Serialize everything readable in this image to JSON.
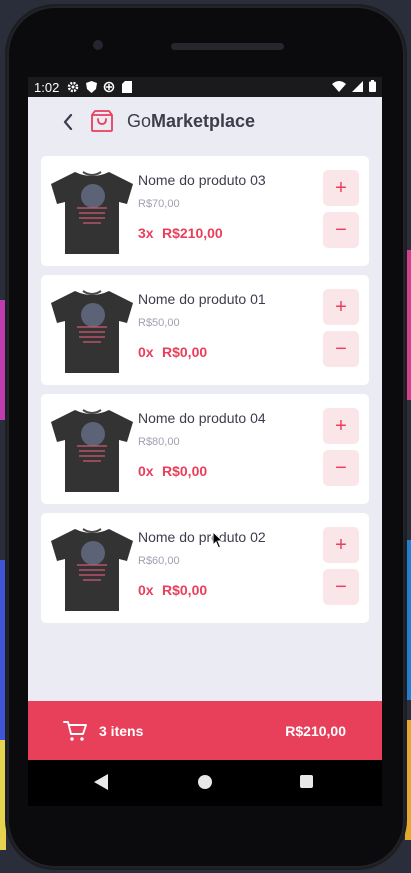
{
  "status": {
    "time": "1:02",
    "icons": [
      "gear-icon",
      "shield-icon",
      "data-saver-icon",
      "sd-card-icon"
    ],
    "right_icons": [
      "wifi-icon",
      "signal-icon",
      "battery-icon"
    ]
  },
  "header": {
    "title_prefix": "Go",
    "title_bold": "Marketplace",
    "back_icon": "chevron-left-icon",
    "logo_icon": "shopping-bag-icon"
  },
  "products": [
    {
      "name": "Nome do produto 03",
      "price": "R$70,00",
      "qty": "3x",
      "total": "R$210,00"
    },
    {
      "name": "Nome do produto 01",
      "price": "R$50,00",
      "qty": "0x",
      "total": "R$0,00"
    },
    {
      "name": "Nome do produto 04",
      "price": "R$80,00",
      "qty": "0x",
      "total": "R$0,00"
    },
    {
      "name": "Nome do produto 02",
      "price": "R$60,00",
      "qty": "0x",
      "total": "R$0,00"
    }
  ],
  "buttons": {
    "plus": "+",
    "minus": "−"
  },
  "footer": {
    "items": "3 itens",
    "total": "R$210,00",
    "cart_icon": "cart-icon"
  },
  "colors": {
    "accent": "#e83f5b",
    "accent_light": "#fae5e8",
    "background": "#ebebf3",
    "text": "#3d3d4d",
    "muted": "#a0a0b3"
  }
}
